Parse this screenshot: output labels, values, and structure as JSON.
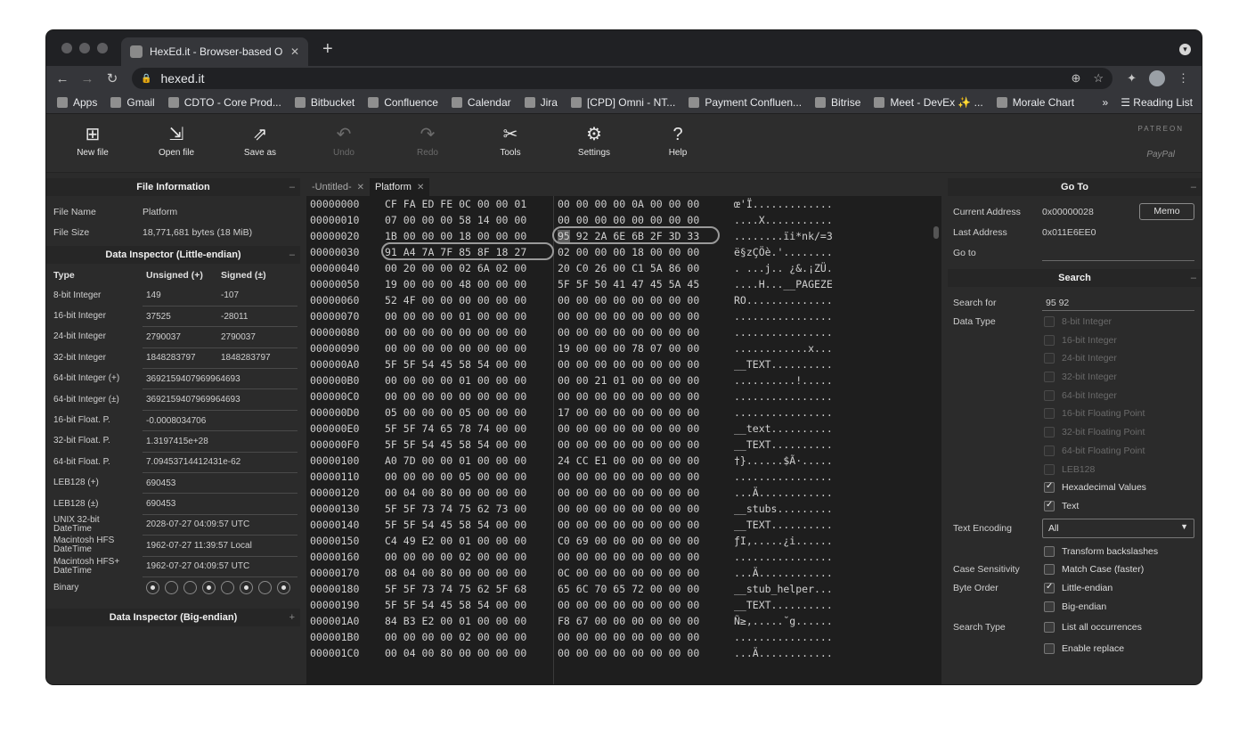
{
  "browser": {
    "tab_title": "HexEd.it - Browser-based Onli",
    "url": "hexed.it"
  },
  "bookmarks": [
    {
      "label": "Apps",
      "icon": "apps-grid-icon"
    },
    {
      "label": "Gmail",
      "icon": "gmail-icon"
    },
    {
      "label": "CDTO - Core Prod...",
      "icon": "drive-icon"
    },
    {
      "label": "Bitbucket",
      "icon": "bitbucket-icon"
    },
    {
      "label": "Confluence",
      "icon": "confluence-icon"
    },
    {
      "label": "Calendar",
      "icon": "calendar-icon"
    },
    {
      "label": "Jira",
      "icon": "jira-icon"
    },
    {
      "label": "[CPD] Omni - NT...",
      "icon": "confluence-icon"
    },
    {
      "label": "Payment Confluen...",
      "icon": "confluence-icon"
    },
    {
      "label": "Bitrise",
      "icon": "bitrise-icon"
    },
    {
      "label": "Meet - DevEx ✨ ...",
      "icon": "meet-icon"
    },
    {
      "label": "Morale Chart",
      "icon": "chart-icon"
    }
  ],
  "bookmarks_overflow": "»",
  "reading_list": "Reading List",
  "app_toolbar": {
    "new_file": "New file",
    "open_file": "Open file",
    "save_as": "Save as",
    "undo": "Undo",
    "redo": "Redo",
    "tools": "Tools",
    "settings": "Settings",
    "help": "Help",
    "patreon": "PATREON",
    "paypal": "PayPal"
  },
  "file_info": {
    "title": "File Information",
    "name_label": "File Name",
    "name_value": "Platform",
    "size_label": "File Size",
    "size_value": "18,771,681 bytes (18 MiB)"
  },
  "inspector": {
    "title": "Data Inspector (Little-endian)",
    "col_type": "Type",
    "col_unsigned": "Unsigned (+)",
    "col_signed": "Signed (±)",
    "rows": [
      {
        "type": "8-bit Integer",
        "u": "149",
        "s": "-107"
      },
      {
        "type": "16-bit Integer",
        "u": "37525",
        "s": "-28011"
      },
      {
        "type": "24-bit Integer",
        "u": "2790037",
        "s": "2790037"
      },
      {
        "type": "32-bit Integer",
        "u": "1848283797",
        "s": "1848283797"
      },
      {
        "type": "64-bit Integer (+)",
        "v": "3692159407969964693"
      },
      {
        "type": "64-bit Integer (±)",
        "v": "3692159407969964693"
      },
      {
        "type": "16-bit Float. P.",
        "v": "-0.0008034706"
      },
      {
        "type": "32-bit Float. P.",
        "v": "1.3197415e+28"
      },
      {
        "type": "64-bit Float. P.",
        "v": "7.09453714412431e-62"
      },
      {
        "type": "LEB128 (+)",
        "v": "690453"
      },
      {
        "type": "LEB128 (±)",
        "v": "690453"
      },
      {
        "type": "UNIX 32-bit DateTime",
        "v": "2028-07-27 04:09:57 UTC"
      },
      {
        "type": "Macintosh HFS DateTime",
        "v": "1962-07-27 11:39:57 Local"
      },
      {
        "type": "Macintosh HFS+ DateTime",
        "v": "1962-07-27 04:09:57 UTC"
      }
    ],
    "binary_label": "Binary",
    "binary_bits": [
      1,
      0,
      0,
      1,
      0,
      1,
      0,
      1
    ],
    "big_endian_title": "Data Inspector (Big-endian)"
  },
  "editor_tabs": [
    {
      "label": "-Untitled-",
      "active": false
    },
    {
      "label": "Platform",
      "active": true
    }
  ],
  "hex_rows": [
    {
      "addr": "00000000",
      "a": "CF FA ED FE 0C 00 00 01",
      "b": "00 00 00 00 0A 00 00 00",
      "t": "œ'Ï............."
    },
    {
      "addr": "00000010",
      "a": "07 00 00 00 58 14 00 00",
      "b": "00 00 00 00 00 00 00 00",
      "t": "....X..........."
    },
    {
      "addr": "00000020",
      "a": "1B 00 00 00 18 00 00 00",
      "b": "95 92 2A 6E 6B 2F 3D 33",
      "t": "........ïi*nk/=3"
    },
    {
      "addr": "00000030",
      "a": "91 A4 7A 7F 85 8F 18 27",
      "b": "02 00 00 00 18 00 00 00",
      "t": "ë§zÇÖè.'........"
    },
    {
      "addr": "00000040",
      "a": "00 20 00 00 02 6A 02 00",
      "b": "20 C0 26 00 C1 5A 86 00",
      "t": ". ...j.. ¿&.¡ZÜ."
    },
    {
      "addr": "00000050",
      "a": "19 00 00 00 48 00 00 00",
      "b": "5F 5F 50 41 47 45 5A 45",
      "t": "....H...__PAGEZE"
    },
    {
      "addr": "00000060",
      "a": "52 4F 00 00 00 00 00 00",
      "b": "00 00 00 00 00 00 00 00",
      "t": "RO.............."
    },
    {
      "addr": "00000070",
      "a": "00 00 00 00 01 00 00 00",
      "b": "00 00 00 00 00 00 00 00",
      "t": "................"
    },
    {
      "addr": "00000080",
      "a": "00 00 00 00 00 00 00 00",
      "b": "00 00 00 00 00 00 00 00",
      "t": "................"
    },
    {
      "addr": "00000090",
      "a": "00 00 00 00 00 00 00 00",
      "b": "19 00 00 00 78 07 00 00",
      "t": "............x..."
    },
    {
      "addr": "000000A0",
      "a": "5F 5F 54 45 58 54 00 00",
      "b": "00 00 00 00 00 00 00 00",
      "t": "__TEXT.........."
    },
    {
      "addr": "000000B0",
      "a": "00 00 00 00 01 00 00 00",
      "b": "00 00 21 01 00 00 00 00",
      "t": "..........!....."
    },
    {
      "addr": "000000C0",
      "a": "00 00 00 00 00 00 00 00",
      "b": "00 00 00 00 00 00 00 00",
      "t": "................"
    },
    {
      "addr": "000000D0",
      "a": "05 00 00 00 05 00 00 00",
      "b": "17 00 00 00 00 00 00 00",
      "t": "................"
    },
    {
      "addr": "000000E0",
      "a": "5F 5F 74 65 78 74 00 00",
      "b": "00 00 00 00 00 00 00 00",
      "t": "__text.........."
    },
    {
      "addr": "000000F0",
      "a": "5F 5F 54 45 58 54 00 00",
      "b": "00 00 00 00 00 00 00 00",
      "t": "__TEXT.........."
    },
    {
      "addr": "00000100",
      "a": "A0 7D 00 00 01 00 00 00",
      "b": "24 CC E1 00 00 00 00 00",
      "t": "†}......$Ã·....."
    },
    {
      "addr": "00000110",
      "a": "00 00 00 00 05 00 00 00",
      "b": "00 00 00 00 00 00 00 00",
      "t": "................"
    },
    {
      "addr": "00000120",
      "a": "00 04 00 80 00 00 00 00",
      "b": "00 00 00 00 00 00 00 00",
      "t": "...Ä............"
    },
    {
      "addr": "00000130",
      "a": "5F 5F 73 74 75 62 73 00",
      "b": "00 00 00 00 00 00 00 00",
      "t": "__stubs........."
    },
    {
      "addr": "00000140",
      "a": "5F 5F 54 45 58 54 00 00",
      "b": "00 00 00 00 00 00 00 00",
      "t": "__TEXT.........."
    },
    {
      "addr": "00000150",
      "a": "C4 49 E2 00 01 00 00 00",
      "b": "C0 69 00 00 00 00 00 00",
      "t": "ƒI,.....¿i......"
    },
    {
      "addr": "00000160",
      "a": "00 00 00 00 02 00 00 00",
      "b": "00 00 00 00 00 00 00 00",
      "t": "................"
    },
    {
      "addr": "00000170",
      "a": "08 04 00 80 00 00 00 00",
      "b": "0C 00 00 00 00 00 00 00",
      "t": "...Ä............"
    },
    {
      "addr": "00000180",
      "a": "5F 5F 73 74 75 62 5F 68",
      "b": "65 6C 70 65 72 00 00 00",
      "t": "__stub_helper..."
    },
    {
      "addr": "00000190",
      "a": "5F 5F 54 45 58 54 00 00",
      "b": "00 00 00 00 00 00 00 00",
      "t": "__TEXT.........."
    },
    {
      "addr": "000001A0",
      "a": "84 B3 E2 00 01 00 00 00",
      "b": "F8 67 00 00 00 00 00 00",
      "t": "Ñ≥,.....˘g......"
    },
    {
      "addr": "000001B0",
      "a": "00 00 00 00 02 00 00 00",
      "b": "00 00 00 00 00 00 00 00",
      "t": "................"
    },
    {
      "addr": "000001C0",
      "a": "00 04 00 80 00 00 00 00",
      "b": "00 00 00 00 00 00 00 00",
      "t": "...Ä............"
    }
  ],
  "goto": {
    "title": "Go To",
    "current_label": "Current Address",
    "current_value": "0x00000028",
    "memo": "Memo",
    "last_label": "Last Address",
    "last_value": "0x011E6EE0",
    "goto_label": "Go to"
  },
  "search": {
    "title": "Search",
    "search_for_label": "Search for",
    "search_for_value": "95 92",
    "data_type_label": "Data Type",
    "types": [
      {
        "label": "8-bit Integer",
        "checked": false,
        "disabled": true
      },
      {
        "label": "16-bit Integer",
        "checked": false,
        "disabled": true
      },
      {
        "label": "24-bit Integer",
        "checked": false,
        "disabled": true
      },
      {
        "label": "32-bit Integer",
        "checked": false,
        "disabled": true
      },
      {
        "label": "64-bit Integer",
        "checked": false,
        "disabled": true
      },
      {
        "label": "16-bit Floating Point",
        "checked": false,
        "disabled": true
      },
      {
        "label": "32-bit Floating Point",
        "checked": false,
        "disabled": true
      },
      {
        "label": "64-bit Floating Point",
        "checked": false,
        "disabled": true
      },
      {
        "label": "LEB128",
        "checked": false,
        "disabled": true
      },
      {
        "label": "Hexadecimal Values",
        "checked": true,
        "disabled": false
      },
      {
        "label": "Text",
        "checked": true,
        "disabled": false
      }
    ],
    "encoding_label": "Text Encoding",
    "encoding_value": "All",
    "transform_label": "Transform backslashes",
    "case_label": "Case Sensitivity",
    "match_case_label": "Match Case (faster)",
    "byte_order_label": "Byte Order",
    "little_endian_label": "Little-endian",
    "big_endian_label": "Big-endian",
    "search_type_label": "Search Type",
    "list_all_label": "List all occurrences",
    "enable_replace_label": "Enable replace"
  }
}
